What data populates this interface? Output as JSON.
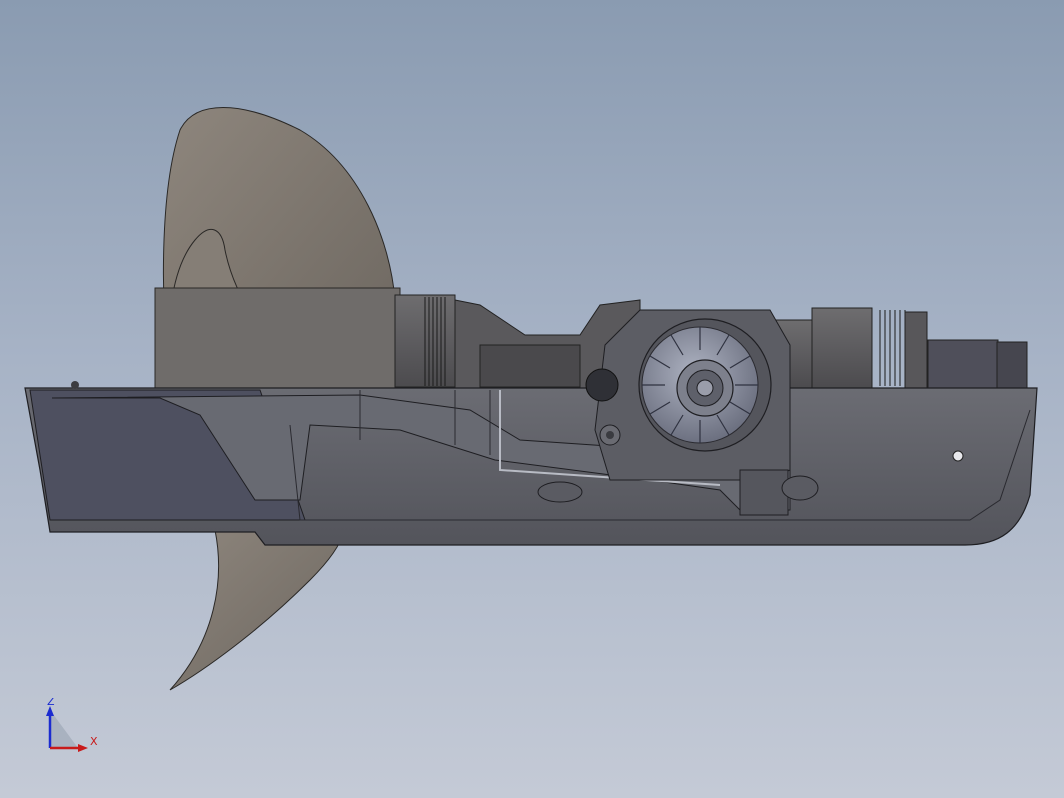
{
  "viewport": {
    "background_top": "#8a9bb1",
    "background_bottom": "#c4cad6"
  },
  "model": {
    "propeller_color": "#7f7870",
    "housing_color": "#5f6068",
    "gear_color": "#8a8f9e"
  },
  "triad": {
    "z_label": "Z",
    "x_label": "X",
    "z_color": "#1b2bd0",
    "x_color": "#c81a1a"
  }
}
